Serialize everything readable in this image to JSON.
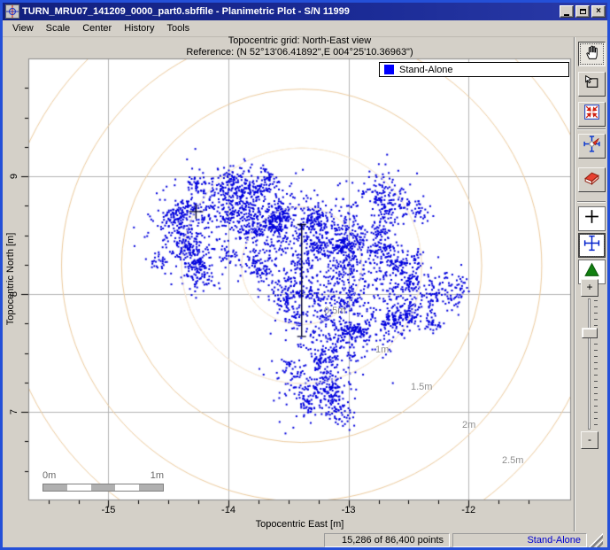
{
  "window": {
    "title": "TURN_MRU07_141209_0000_part0.sbffile - Planimetric Plot - S/N 11999",
    "buttons": {
      "minimize": "minimize",
      "maximize": "maximize",
      "close": "×"
    }
  },
  "menu": {
    "items": [
      "View",
      "Scale",
      "Center",
      "History",
      "Tools"
    ]
  },
  "header": {
    "line1": "Topocentric grid: North-East view",
    "line2": "Reference: (N 52°13'06.41892\",E 004°25'10.36963\")"
  },
  "legend": {
    "label": "Stand-Alone",
    "swatch_color": "#0000ff"
  },
  "axes": {
    "x_label": "Topocentric East [m]",
    "y_label": "Topocentric North [m]",
    "x_ticks": [
      -15,
      -14,
      -13,
      -12
    ],
    "y_ticks": [
      9,
      8,
      7
    ]
  },
  "scalebar": {
    "left_label": "0m",
    "right_label": "1m"
  },
  "status": {
    "points_text": "15,286 of 86,400 points",
    "mode_text": "Stand-Alone"
  },
  "toolbar": {
    "buttons": [
      {
        "name": "pan-tool-button",
        "icon": "hand-icon",
        "pressed": true,
        "flat": false,
        "sep_after": false
      },
      {
        "name": "select-tool-button",
        "icon": "select-rectangle-icon",
        "pressed": false,
        "flat": false,
        "sep_after": false
      },
      {
        "name": "zoom-extents-button",
        "icon": "zoom-extents-icon",
        "pressed": false,
        "flat": false,
        "sep_after": true
      },
      {
        "name": "center-on-point-button",
        "icon": "center-target-icon",
        "pressed": false,
        "flat": false,
        "sep_after": false
      },
      {
        "name": "erase-button",
        "icon": "eraser-icon",
        "pressed": false,
        "flat": false,
        "sep_after": true
      },
      {
        "name": "marker-plus-button",
        "icon": "plus-marker-icon",
        "pressed": false,
        "flat": true,
        "sep_after": false
      },
      {
        "name": "marker-crosshair-button",
        "icon": "crosshair-marker-icon",
        "pressed": true,
        "flat": true,
        "sep_after": false
      },
      {
        "name": "marker-triangle-button",
        "icon": "triangle-marker-icon",
        "pressed": false,
        "flat": true,
        "sep_after": false
      }
    ]
  },
  "slider": {
    "plus_label": "+",
    "minus_label": "-"
  },
  "chart_data": {
    "type": "scatter",
    "series": [
      {
        "name": "Stand-Alone",
        "color": "#0000dd",
        "marker": "square-dot"
      }
    ],
    "xlabel": "Topocentric East [m]",
    "ylabel": "Topocentric North [m]",
    "xlim": [
      -15.67,
      -11.15
    ],
    "ylim": [
      6.25,
      10.0
    ],
    "x_ticks": [
      -15,
      -14,
      -13,
      -12
    ],
    "y_ticks": [
      7,
      8,
      9
    ],
    "grid": true,
    "range_rings": {
      "center_east": -13.39,
      "center_north": 8.24,
      "radii_m": [
        0.5,
        1.0,
        1.5,
        2.0,
        2.5
      ],
      "labels": [
        "0.5m",
        "1m",
        "1.5m",
        "2m",
        "2.5m"
      ],
      "ring_color": "#edcb9d",
      "label_color": "#8f8f8f"
    },
    "markers": [
      {
        "type": "vertical-error-bar",
        "east": -13.39,
        "north_from": 7.64,
        "north_to": 8.59
      },
      {
        "type": "cross",
        "east": -14.27,
        "north": 8.7
      }
    ],
    "point_clusters_approx": [
      {
        "east": -14.02,
        "north": 8.76,
        "sde": 0.27,
        "sdn": 0.16,
        "n": 520
      },
      {
        "east": -14.4,
        "north": 8.5,
        "sde": 0.15,
        "sdn": 0.13,
        "n": 260
      },
      {
        "east": -14.19,
        "north": 8.24,
        "sde": 0.12,
        "sdn": 0.14,
        "n": 150
      },
      {
        "east": -13.66,
        "north": 8.58,
        "sde": 0.17,
        "sdn": 0.18,
        "n": 300
      },
      {
        "east": -13.32,
        "north": 8.4,
        "sde": 0.2,
        "sdn": 0.2,
        "n": 430
      },
      {
        "east": -13.0,
        "north": 8.58,
        "sde": 0.15,
        "sdn": 0.14,
        "n": 240
      },
      {
        "east": -12.67,
        "north": 8.82,
        "sde": 0.12,
        "sdn": 0.13,
        "n": 210
      },
      {
        "east": -13.03,
        "north": 8.08,
        "sde": 0.2,
        "sdn": 0.16,
        "n": 340
      },
      {
        "east": -12.46,
        "north": 8.02,
        "sde": 0.18,
        "sdn": 0.14,
        "n": 310
      },
      {
        "east": -12.19,
        "north": 8.08,
        "sde": 0.09,
        "sdn": 0.1,
        "n": 80
      },
      {
        "east": -13.1,
        "north": 7.64,
        "sde": 0.18,
        "sdn": 0.17,
        "n": 370
      },
      {
        "east": -13.33,
        "north": 7.25,
        "sde": 0.15,
        "sdn": 0.14,
        "n": 220
      },
      {
        "east": -13.17,
        "north": 7.03,
        "sde": 0.12,
        "sdn": 0.08,
        "n": 110
      },
      {
        "east": -13.47,
        "north": 8.02,
        "sde": 0.1,
        "sdn": 0.13,
        "n": 140
      },
      {
        "east": -12.78,
        "north": 8.32,
        "sde": 0.1,
        "sdn": 0.1,
        "n": 110
      },
      {
        "east": -12.63,
        "north": 7.75,
        "sde": 0.12,
        "sdn": 0.1,
        "n": 140
      },
      {
        "east": -13.7,
        "north": 8.24,
        "sde": 0.08,
        "sdn": 0.1,
        "n": 90
      },
      {
        "east": -13.92,
        "north": 8.9,
        "sde": 0.14,
        "sdn": 0.08,
        "n": 140
      }
    ]
  }
}
